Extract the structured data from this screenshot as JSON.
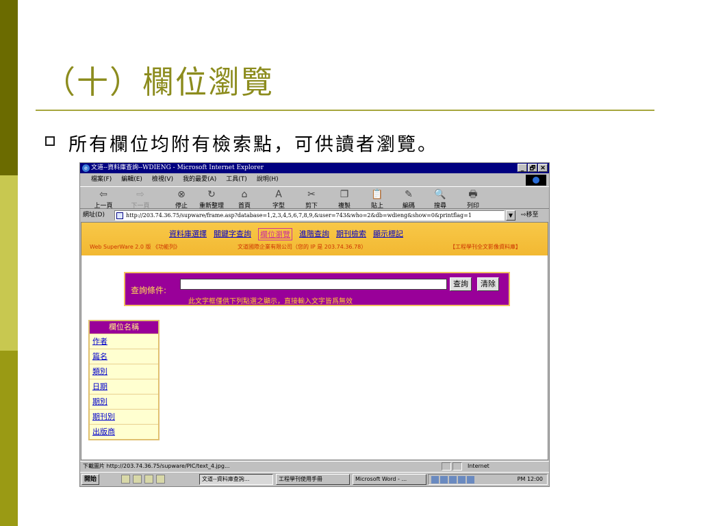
{
  "slide": {
    "title": "（十）欄位瀏覽",
    "bullet": "所有欄位均附有檢索點，可供讀者瀏覽。"
  },
  "window": {
    "title": "文道--資料庫查詢--WDIENG - Microsoft Internet Explorer",
    "controls": [
      "_",
      "🗗",
      "✕"
    ]
  },
  "menu": [
    "檔案(F)",
    "編輯(E)",
    "檢視(V)",
    "我的最愛(A)",
    "工具(T)",
    "說明(H)"
  ],
  "toolbar": {
    "buttons": [
      {
        "label": "上一頁",
        "glyph": "⇦",
        "enabled": true
      },
      {
        "label": "下一頁",
        "glyph": "⇨",
        "enabled": false
      },
      {
        "label": "停止",
        "glyph": "⊗",
        "enabled": true
      },
      {
        "label": "重新整理",
        "glyph": "↻",
        "enabled": true
      },
      {
        "label": "首頁",
        "glyph": "⌂",
        "enabled": true
      },
      {
        "label": "字型",
        "glyph": "A",
        "enabled": true
      },
      {
        "label": "剪下",
        "glyph": "✂",
        "enabled": true
      },
      {
        "label": "複製",
        "glyph": "❐",
        "enabled": true
      },
      {
        "label": "貼上",
        "glyph": "📋",
        "enabled": true
      },
      {
        "label": "編碼",
        "glyph": "✎",
        "enabled": true
      },
      {
        "label": "搜尋",
        "glyph": "🔍",
        "enabled": true
      },
      {
        "label": "列印",
        "glyph": "🖶",
        "enabled": true
      }
    ]
  },
  "address": {
    "label": "網址(D)",
    "url": "http://203.74.36.75/supware/frame.asp?database=1,2,3,4,5,6,7,8,9,&user=743&who=2&db=wdieng&show=0&printflag=1",
    "go": "⇨移至"
  },
  "nav": {
    "links": [
      "資料庫選擇",
      "關鍵字查詢",
      "欄位瀏覽",
      "進階查詢",
      "期刊檢索",
      "顯示標記"
    ],
    "active_index": 2
  },
  "band": {
    "version": "Web SuperWare 2.0 版 《功能列》",
    "company": "文道國際企業有限公司（您的 IP 是 203.74.36.78）",
    "database": "【工程學刊全文影像資料庫】"
  },
  "query": {
    "label": "查詢條件:",
    "value": "",
    "search_button": "查詢",
    "clear_button": "清除",
    "note": "此文字框僅供下列點選之顯示，直接輸入文字皆爲無效"
  },
  "fields": {
    "header": "欄位名稱",
    "items": [
      "作者",
      "篇名",
      "類別",
      "日期",
      "期別",
      "期刊別",
      "出版商"
    ]
  },
  "status": {
    "text": "下載圖片 http://203.74.36.75/supware/PIC/text_4.jpg...",
    "zone": "Internet"
  },
  "taskbar": {
    "start": "開始",
    "tasks": [
      "文道--資料庫查詢...",
      "工程學刊使用手冊",
      "Microsoft Word - ..."
    ],
    "clock": "PM 12:00"
  }
}
